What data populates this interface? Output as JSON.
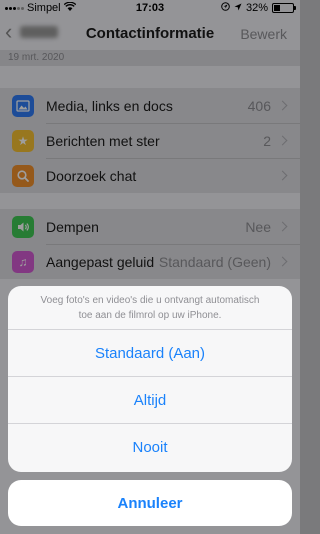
{
  "status_bar": {
    "carrier": "Simpel",
    "time": "17:03",
    "battery": "32%",
    "battery_level": 0.32
  },
  "nav": {
    "title": "Contactinformatie",
    "edit_label": "Bewerk"
  },
  "date_header": "19 mrt. 2020",
  "groups": [
    {
      "rows": [
        {
          "label": "Media, links en docs",
          "value": "406",
          "icon": "photo-icon",
          "color": "#2f7bf5"
        },
        {
          "label": "Berichten met ster",
          "value": "2",
          "icon": "star-icon",
          "color": "#f6c133"
        },
        {
          "label": "Doorzoek chat",
          "value": "",
          "icon": "search-icon",
          "color": "#f1902d"
        }
      ]
    },
    {
      "rows": [
        {
          "label": "Dempen",
          "value": "Nee",
          "icon": "speaker-icon",
          "color": "#3fc955"
        },
        {
          "label": "Aangepast geluid",
          "value": "Standaard (Geen)",
          "icon": "music-note-icon",
          "color": "#d25bd2"
        }
      ]
    }
  ],
  "action_sheet": {
    "message": "Voeg foto's en video's die u ontvangt automatisch toe aan de filmrol op uw iPhone.",
    "options": [
      "Standaard (Aan)",
      "Altijd",
      "Nooit"
    ],
    "cancel_label": "Annuleer"
  },
  "colors": {
    "accent": "#1a82fb",
    "background": "#efeff4"
  }
}
